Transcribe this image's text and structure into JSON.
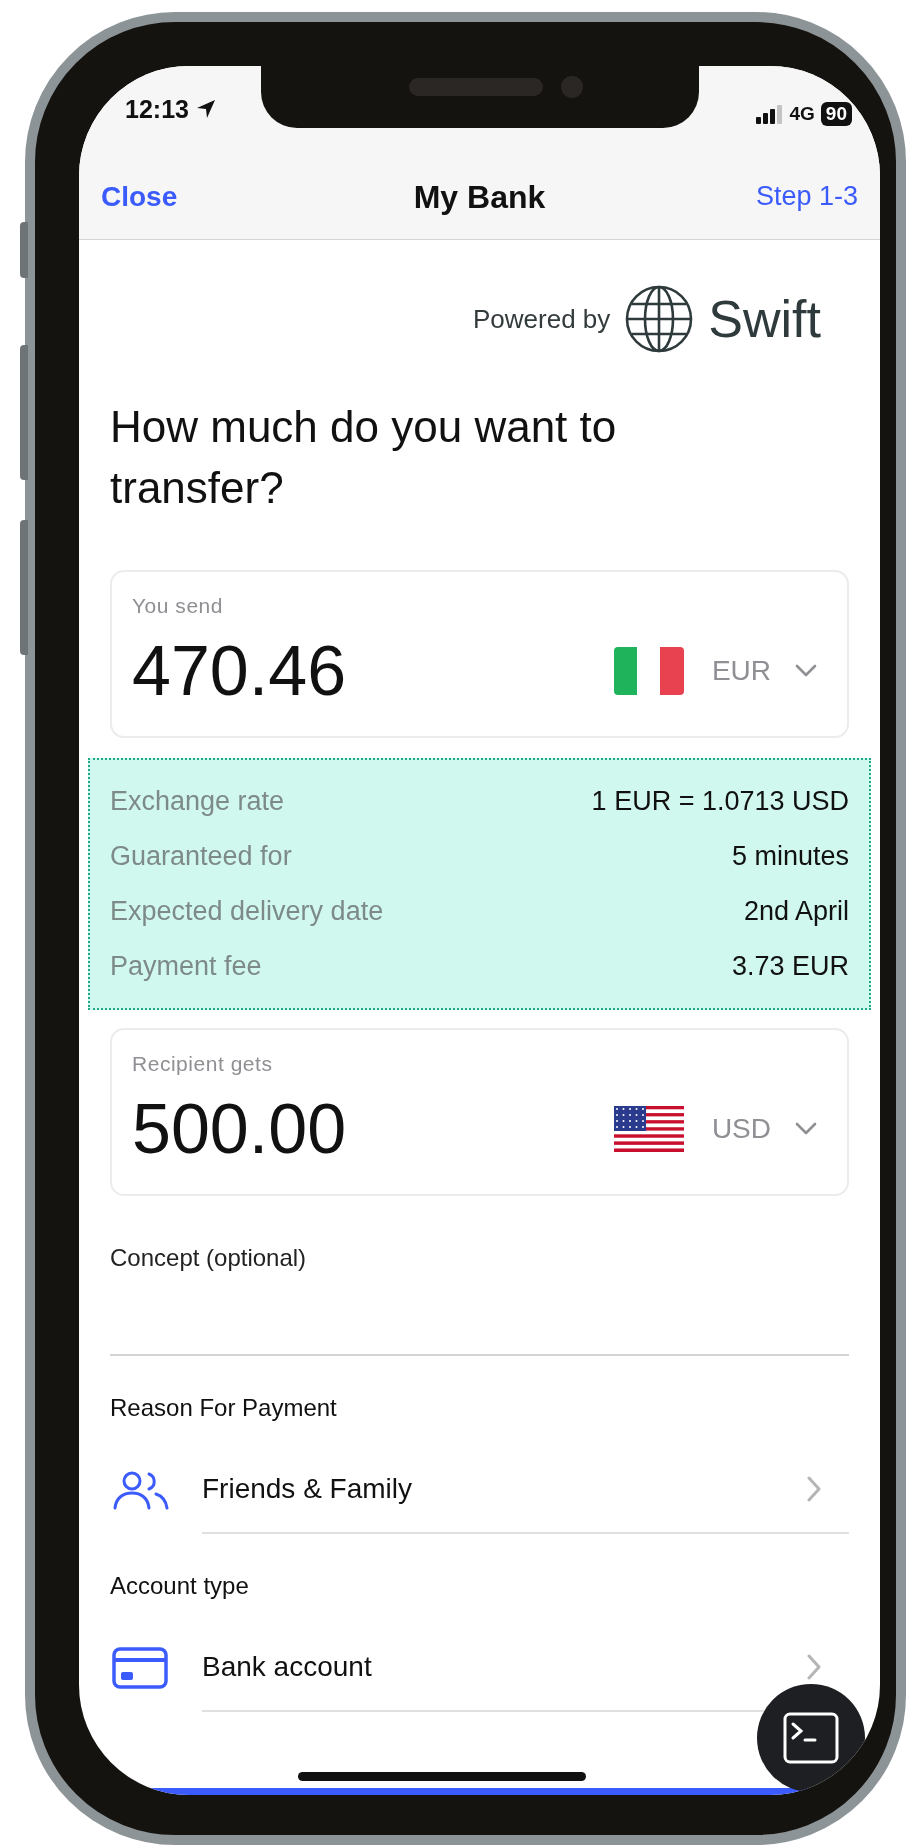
{
  "status_bar": {
    "time": "12:13",
    "network": "4G",
    "battery": "90"
  },
  "nav": {
    "left": "Close",
    "title": "My Bank",
    "right": "Step 1-3"
  },
  "powered_by": {
    "label": "Powered by",
    "brand": "Swift"
  },
  "heading": "How much do you want to transfer?",
  "amount_cards": [
    {
      "label": "You send",
      "amount": "470.46",
      "currency": "EUR"
    },
    {
      "label": "Recipient gets",
      "amount": "500.00",
      "currency": "USD"
    }
  ],
  "details": [
    {
      "label": "Exchange rate",
      "value": "1 EUR = 1.0713 USD"
    },
    {
      "label": "Guaranteed for",
      "value": "5 minutes"
    },
    {
      "label": "Expected delivery date",
      "value": "2nd April"
    },
    {
      "label": "Payment fee",
      "value": "3.73 EUR"
    }
  ],
  "concept_field": {
    "label": "Concept (optional)"
  },
  "sections": [
    {
      "title": "Reason For Payment",
      "value": "Friends & Family"
    },
    {
      "title": "Account type",
      "value": "Bank account"
    }
  ]
}
